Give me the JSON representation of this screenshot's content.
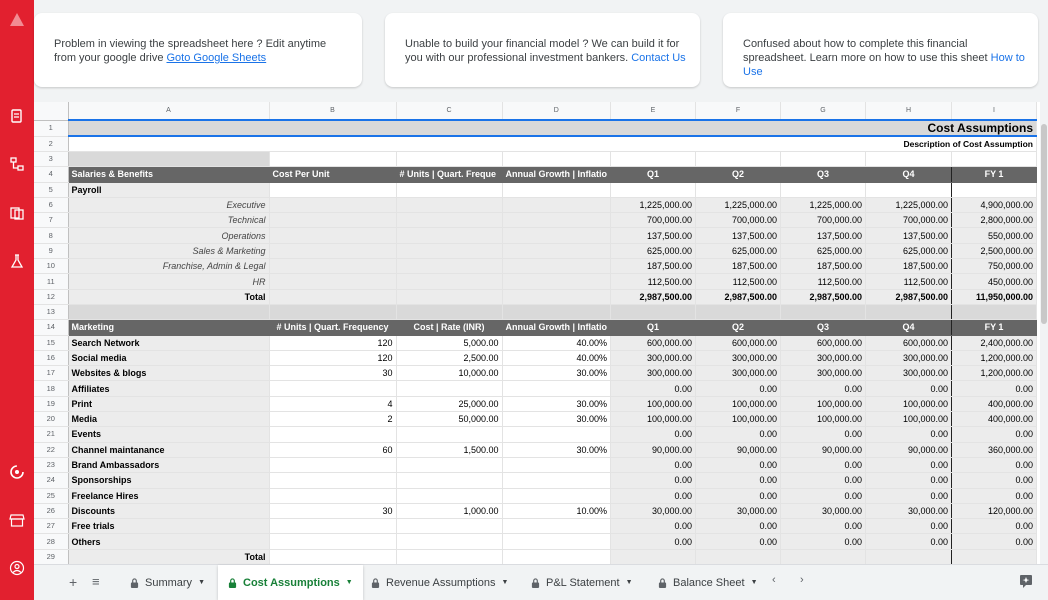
{
  "banner": {
    "card1": {
      "text": "Problem in viewing the spreadsheet here ? Edit anytime from your google drive ",
      "link": "Goto Google Sheets"
    },
    "card2": {
      "text": "Unable to build your financial model ? We can build it for you with our professional investment bankers. ",
      "link": "Contact Us"
    },
    "card3": {
      "text": "Confused about how to complete this financial spreadsheet. Learn more on how to use this sheet ",
      "link": "How to Use"
    }
  },
  "columns": [
    "A",
    "B",
    "C",
    "D",
    "E",
    "F",
    "G",
    "H",
    "I"
  ],
  "rows": [
    "1",
    "2",
    "3",
    "4",
    "5",
    "6",
    "7",
    "8",
    "9",
    "10",
    "11",
    "12",
    "13",
    "14",
    "15",
    "16",
    "17",
    "18",
    "19",
    "20",
    "21",
    "22",
    "23",
    "24",
    "25",
    "26",
    "27",
    "28",
    "29"
  ],
  "sheet": {
    "title": "Cost Assumptions",
    "description": "Description of Cost Assumption",
    "salaries": {
      "header": [
        "Salaries & Benefits",
        "Cost Per Unit",
        "# Units | Quart. Freque",
        "Annual Growth | Inflatio",
        "Q1",
        "Q2",
        "Q3",
        "Q4",
        "FY 1"
      ],
      "payroll_label": "Payroll",
      "rows": [
        {
          "label": "Executive",
          "q1": "1,225,000.00",
          "q2": "1,225,000.00",
          "q3": "1,225,000.00",
          "q4": "1,225,000.00",
          "fy": "4,900,000.00"
        },
        {
          "label": "Technical",
          "q1": "700,000.00",
          "q2": "700,000.00",
          "q3": "700,000.00",
          "q4": "700,000.00",
          "fy": "2,800,000.00"
        },
        {
          "label": "Operations",
          "q1": "137,500.00",
          "q2": "137,500.00",
          "q3": "137,500.00",
          "q4": "137,500.00",
          "fy": "550,000.00"
        },
        {
          "label": "Sales & Marketing",
          "q1": "625,000.00",
          "q2": "625,000.00",
          "q3": "625,000.00",
          "q4": "625,000.00",
          "fy": "2,500,000.00"
        },
        {
          "label": "Franchise, Admin & Legal",
          "q1": "187,500.00",
          "q2": "187,500.00",
          "q3": "187,500.00",
          "q4": "187,500.00",
          "fy": "750,000.00"
        },
        {
          "label": "HR",
          "q1": "112,500.00",
          "q2": "112,500.00",
          "q3": "112,500.00",
          "q4": "112,500.00",
          "fy": "450,000.00"
        }
      ],
      "total": {
        "label": "Total",
        "q1": "2,987,500.00",
        "q2": "2,987,500.00",
        "q3": "2,987,500.00",
        "q4": "2,987,500.00",
        "fy": "11,950,000.00"
      }
    },
    "marketing": {
      "header": [
        "Marketing",
        "# Units | Quart. Frequency",
        "Cost | Rate (INR)",
        "Annual Growth | Inflatio",
        "Q1",
        "Q2",
        "Q3",
        "Q4",
        "FY 1"
      ],
      "rows": [
        {
          "label": "Search Network",
          "units": "120",
          "rate": "5,000.00",
          "growth": "40.00%",
          "q1": "600,000.00",
          "q2": "600,000.00",
          "q3": "600,000.00",
          "q4": "600,000.00",
          "fy": "2,400,000.00"
        },
        {
          "label": "Social media",
          "units": "120",
          "rate": "2,500.00",
          "growth": "40.00%",
          "q1": "300,000.00",
          "q2": "300,000.00",
          "q3": "300,000.00",
          "q4": "300,000.00",
          "fy": "1,200,000.00"
        },
        {
          "label": "Websites & blogs",
          "units": "30",
          "rate": "10,000.00",
          "growth": "30.00%",
          "q1": "300,000.00",
          "q2": "300,000.00",
          "q3": "300,000.00",
          "q4": "300,000.00",
          "fy": "1,200,000.00"
        },
        {
          "label": "Affiliates",
          "units": "",
          "rate": "",
          "growth": "",
          "q1": "0.00",
          "q2": "0.00",
          "q3": "0.00",
          "q4": "0.00",
          "fy": "0.00"
        },
        {
          "label": "Print",
          "units": "4",
          "rate": "25,000.00",
          "growth": "30.00%",
          "q1": "100,000.00",
          "q2": "100,000.00",
          "q3": "100,000.00",
          "q4": "100,000.00",
          "fy": "400,000.00"
        },
        {
          "label": "Media",
          "units": "2",
          "rate": "50,000.00",
          "growth": "30.00%",
          "q1": "100,000.00",
          "q2": "100,000.00",
          "q3": "100,000.00",
          "q4": "100,000.00",
          "fy": "400,000.00"
        },
        {
          "label": "Events",
          "units": "",
          "rate": "",
          "growth": "",
          "q1": "0.00",
          "q2": "0.00",
          "q3": "0.00",
          "q4": "0.00",
          "fy": "0.00"
        },
        {
          "label": "Channel maintanance",
          "units": "60",
          "rate": "1,500.00",
          "growth": "30.00%",
          "q1": "90,000.00",
          "q2": "90,000.00",
          "q3": "90,000.00",
          "q4": "90,000.00",
          "fy": "360,000.00"
        },
        {
          "label": "Brand Ambassadors",
          "units": "",
          "rate": "",
          "growth": "",
          "q1": "0.00",
          "q2": "0.00",
          "q3": "0.00",
          "q4": "0.00",
          "fy": "0.00"
        },
        {
          "label": "Sponsorships",
          "units": "",
          "rate": "",
          "growth": "",
          "q1": "0.00",
          "q2": "0.00",
          "q3": "0.00",
          "q4": "0.00",
          "fy": "0.00"
        },
        {
          "label": "Freelance Hires",
          "units": "",
          "rate": "",
          "growth": "",
          "q1": "0.00",
          "q2": "0.00",
          "q3": "0.00",
          "q4": "0.00",
          "fy": "0.00"
        },
        {
          "label": "Discounts",
          "units": "30",
          "rate": "1,000.00",
          "growth": "10.00%",
          "q1": "30,000.00",
          "q2": "30,000.00",
          "q3": "30,000.00",
          "q4": "30,000.00",
          "fy": "120,000.00"
        },
        {
          "label": "Free trials",
          "units": "",
          "rate": "",
          "growth": "",
          "q1": "0.00",
          "q2": "0.00",
          "q3": "0.00",
          "q4": "0.00",
          "fy": "0.00"
        },
        {
          "label": "Others",
          "units": "",
          "rate": "",
          "growth": "",
          "q1": "0.00",
          "q2": "0.00",
          "q3": "0.00",
          "q4": "0.00",
          "fy": "0.00"
        }
      ],
      "total_label": "Total"
    }
  },
  "tabs": [
    {
      "label": "Summary"
    },
    {
      "label": "Cost Assumptions"
    },
    {
      "label": "Revenue Assumptions"
    },
    {
      "label": "P&L Statement"
    },
    {
      "label": "Balance Sheet"
    }
  ],
  "colors": {
    "rail": "#e2202f",
    "active_tab": "#188038",
    "link": "#1a73e8",
    "header_fill": "#666666"
  },
  "icons": [
    "logo-icon",
    "document-icon",
    "org-chart-icon",
    "copy-icon",
    "flask-icon",
    "spinner-icon",
    "store-icon",
    "profile-icon",
    "add-sheet-icon",
    "all-sheets-icon",
    "lock-icon",
    "explore-icon"
  ]
}
